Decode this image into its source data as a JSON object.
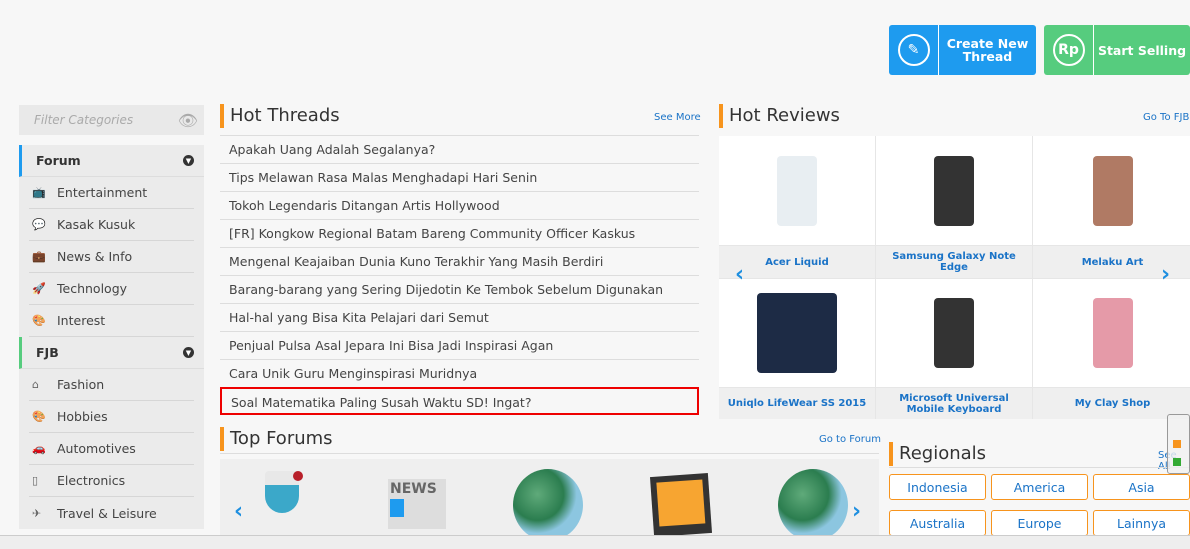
{
  "actions": {
    "create_thread": "Create New Thread",
    "start_selling": "Start Selling",
    "rp": "Rp"
  },
  "sidebar": {
    "filter_placeholder": "Filter Categories",
    "sections": [
      {
        "label": "Forum",
        "color": "#1e9bef",
        "items": [
          {
            "label": "Entertainment",
            "icon": "tv-icon"
          },
          {
            "label": "Kasak Kusuk",
            "icon": "chat-icon"
          },
          {
            "label": "News & Info",
            "icon": "briefcase-icon"
          },
          {
            "label": "Technology",
            "icon": "rocket-icon"
          },
          {
            "label": "Interest",
            "icon": "palette-icon"
          }
        ]
      },
      {
        "label": "FJB",
        "color": "#56cc7e",
        "items": [
          {
            "label": "Fashion",
            "icon": "hanger-icon"
          },
          {
            "label": "Hobbies",
            "icon": "palette-icon"
          },
          {
            "label": "Automotives",
            "icon": "car-icon"
          },
          {
            "label": "Electronics",
            "icon": "device-icon"
          },
          {
            "label": "Travel & Leisure",
            "icon": "plane-icon"
          }
        ]
      }
    ]
  },
  "hot_threads": {
    "title": "Hot Threads",
    "more": "See More",
    "items": [
      "Apakah Uang Adalah Segalanya?",
      "Tips Melawan Rasa Malas Menghadapi Hari Senin",
      "Tokoh Legendaris Ditangan Artis Hollywood",
      "[FR] Kongkow Regional Batam Bareng Community Officer Kaskus",
      "Mengenal Keajaiban Dunia Kuno Terakhir Yang Masih Berdiri",
      "Barang-barang yang Sering Dijedotin Ke Tembok Sebelum Digunakan",
      "Hal-hal yang Bisa Kita Pelajari dari Semut",
      "Penjual Pulsa Asal Jepara Ini Bisa Jadi Inspirasi Agan",
      "Cara Unik Guru Menginspirasi Muridnya",
      "Soal Matematika Paling Susah Waktu SD! Ingat?"
    ]
  },
  "hot_reviews": {
    "title": "Hot Reviews",
    "more": "Go To FJB",
    "items": [
      "Acer Liquid",
      "Samsung Galaxy Note Edge",
      "Melaku Art",
      "Uniqlo LifeWear SS 2015",
      "Microsoft Universal Mobile Keyboard",
      "My Clay Shop"
    ]
  },
  "top_forums": {
    "title": "Top Forums",
    "more": "Go to Forum",
    "news": "NEWS"
  },
  "regionals": {
    "title": "Regionals",
    "more": "See All",
    "items": [
      "Indonesia",
      "America",
      "Asia",
      "Australia",
      "Europe",
      "Lainnya"
    ]
  }
}
